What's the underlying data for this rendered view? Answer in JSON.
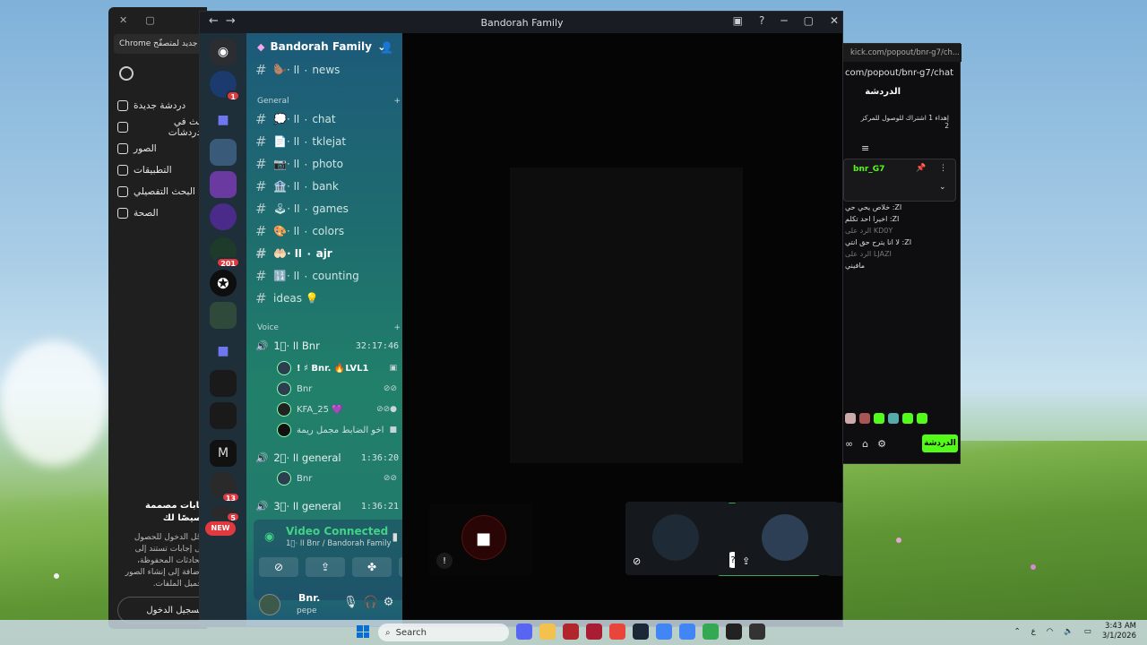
{
  "discord": {
    "window_title": "Bandorah Family",
    "server_name": "Bandorah Family",
    "new_badge": "NEW",
    "server_badges": [
      "1",
      "201",
      "13",
      "5"
    ],
    "channels_top": [
      {
        "name": "🦫⋅ ٠ اا news"
      }
    ],
    "category_general": "General",
    "channels": [
      {
        "name": "💭⋅ ٠ اا chat",
        "bold": false
      },
      {
        "name": "📄⋅ ٠ اا tklejat",
        "bold": false
      },
      {
        "name": "📷⋅ ٠ اا photo",
        "bold": false
      },
      {
        "name": "🏦⋅ ٠ اا bank",
        "bold": false
      },
      {
        "name": "🕹⋅ ٠ اا games",
        "bold": false
      },
      {
        "name": "🎨⋅ ٠ اا colors",
        "bold": false
      },
      {
        "name": "🤲🏻⋅ ٠ اا ajr",
        "bold": true
      },
      {
        "name": "🔢⋅ ٠ اا counting",
        "bold": false
      },
      {
        "name": "ideas 💡",
        "bold": false
      }
    ],
    "category_voice": "Voice",
    "voice_channels": [
      {
        "name": "1⃣⋅ اا Bnr",
        "time": "32:17:46"
      },
      {
        "name": "2⃣⋅ اا general",
        "time": "1:36:20"
      },
      {
        "name": "3⃣⋅ اا general",
        "time": "1:36:21"
      }
    ],
    "voice_users_bnr": [
      {
        "name": "! ♯ Bnr. 🔥LVL1"
      },
      {
        "name": "Bnr"
      },
      {
        "name": "KFA_25 💜"
      },
      {
        "name": "اخو الضابط مجمل ريمة"
      }
    ],
    "voice_users_general": [
      {
        "name": "Bnr"
      }
    ],
    "video_connected": "Video Connected",
    "video_sub": "1⃣⋅ اا Bnr / Bandorah Family",
    "username": "Bnr.",
    "user_status": "pepe"
  },
  "chrome": {
    "banner": "Chrome جديد لمتصفّح",
    "menu": [
      "دردشة جديدة",
      "بحث في الدردشات",
      "الصور",
      "التطبيقات",
      "البحث التفصيلي",
      "الصحة"
    ],
    "promo_title": "إجابات مصممة خصيصًا لك",
    "promo_text": "سجّل الدخول للحصول على إجابات تستند إلى المحادثات المحفوظة، بالإضافة إلى إنشاء الصور وتحميل الملفات.",
    "login_btn": "تسجيل الدخول"
  },
  "kick": {
    "tab_url": "kick.com/popout/bnr-g7/ch...",
    "address": "com/popout/bnr-g7/chat",
    "title": "الدردشة",
    "reward_text": "إهداء 1 اشتراك للوصول للمركز 2",
    "pinned_user": "bnr_G7",
    "messages": [
      {
        "text": "خلاص يحي حي :ZI",
        "dim": false
      },
      {
        "text": "اخيرا احد تكلم :ZI",
        "dim": false
      },
      {
        "text": "الرد على KD0Y",
        "dim": true
      },
      {
        "text": "لا انا يترح حق انتي :ZI",
        "dim": false
      },
      {
        "text": "الرد على LJAZI",
        "dim": true
      },
      {
        "text": "مافيني",
        "dim": false
      }
    ],
    "send_btn": "الدردشة"
  },
  "taskbar": {
    "search": "Search",
    "time": "3:43 AM",
    "date": "3/1/2026",
    "lang": "ع"
  }
}
